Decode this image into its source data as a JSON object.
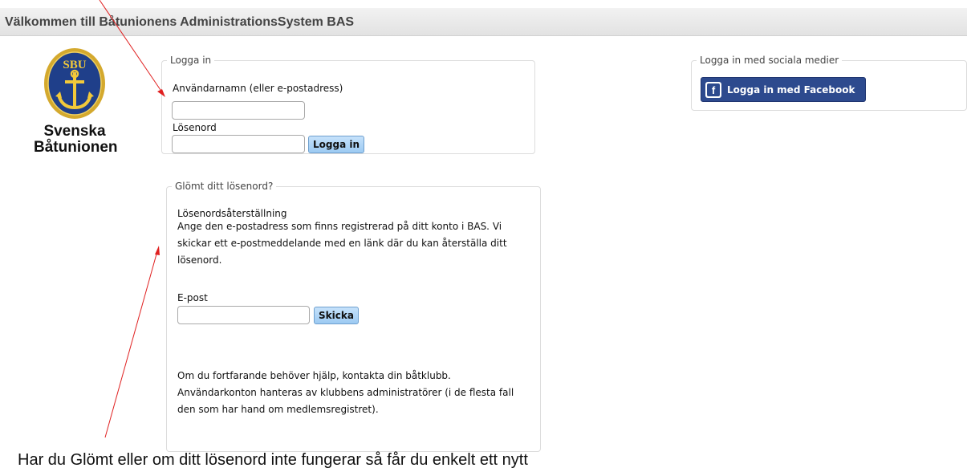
{
  "header": {
    "title": "Välkommen till Båtunionens AdministrationsSystem BAS"
  },
  "logo": {
    "emblem_text": "SBU",
    "line1": "Svenska",
    "line2": "Båtunionen",
    "icon": "anchor-icon"
  },
  "login": {
    "legend": "Logga in",
    "username_label": "Användarnamn (eller e-postadress)",
    "username_value": "",
    "password_label": "Lösenord",
    "password_value": "",
    "submit_label": "Logga in"
  },
  "social": {
    "legend": "Logga in med sociala medier",
    "facebook_label": "Logga in med Facebook",
    "facebook_icon": "facebook-icon",
    "facebook_color": "#2d4a8e"
  },
  "forgot": {
    "legend": "Glömt ditt lösenord?",
    "heading": "Lösenordsåterställning",
    "description_lines": [
      "Ange den e-postadress som finns registrerad på ditt konto i BAS. Vi",
      "skickar ett e-postmeddelande med en länk där du kan återställa ditt",
      "lösenord."
    ],
    "email_label": "E-post",
    "email_value": "",
    "submit_label": "Skicka",
    "help_lines": [
      "Om du fortfarande behöver hjälp, kontakta din båtklubb.",
      "Användarkonton hanteras av klubbens administratörer (i de flesta fall",
      "den som har hand om medlemsregistret)."
    ]
  },
  "annotation": {
    "text": "Har du Glömt eller om ditt lösenord inte fungerar så får du enkelt ett nytt",
    "arrow_color": "#e02020"
  }
}
